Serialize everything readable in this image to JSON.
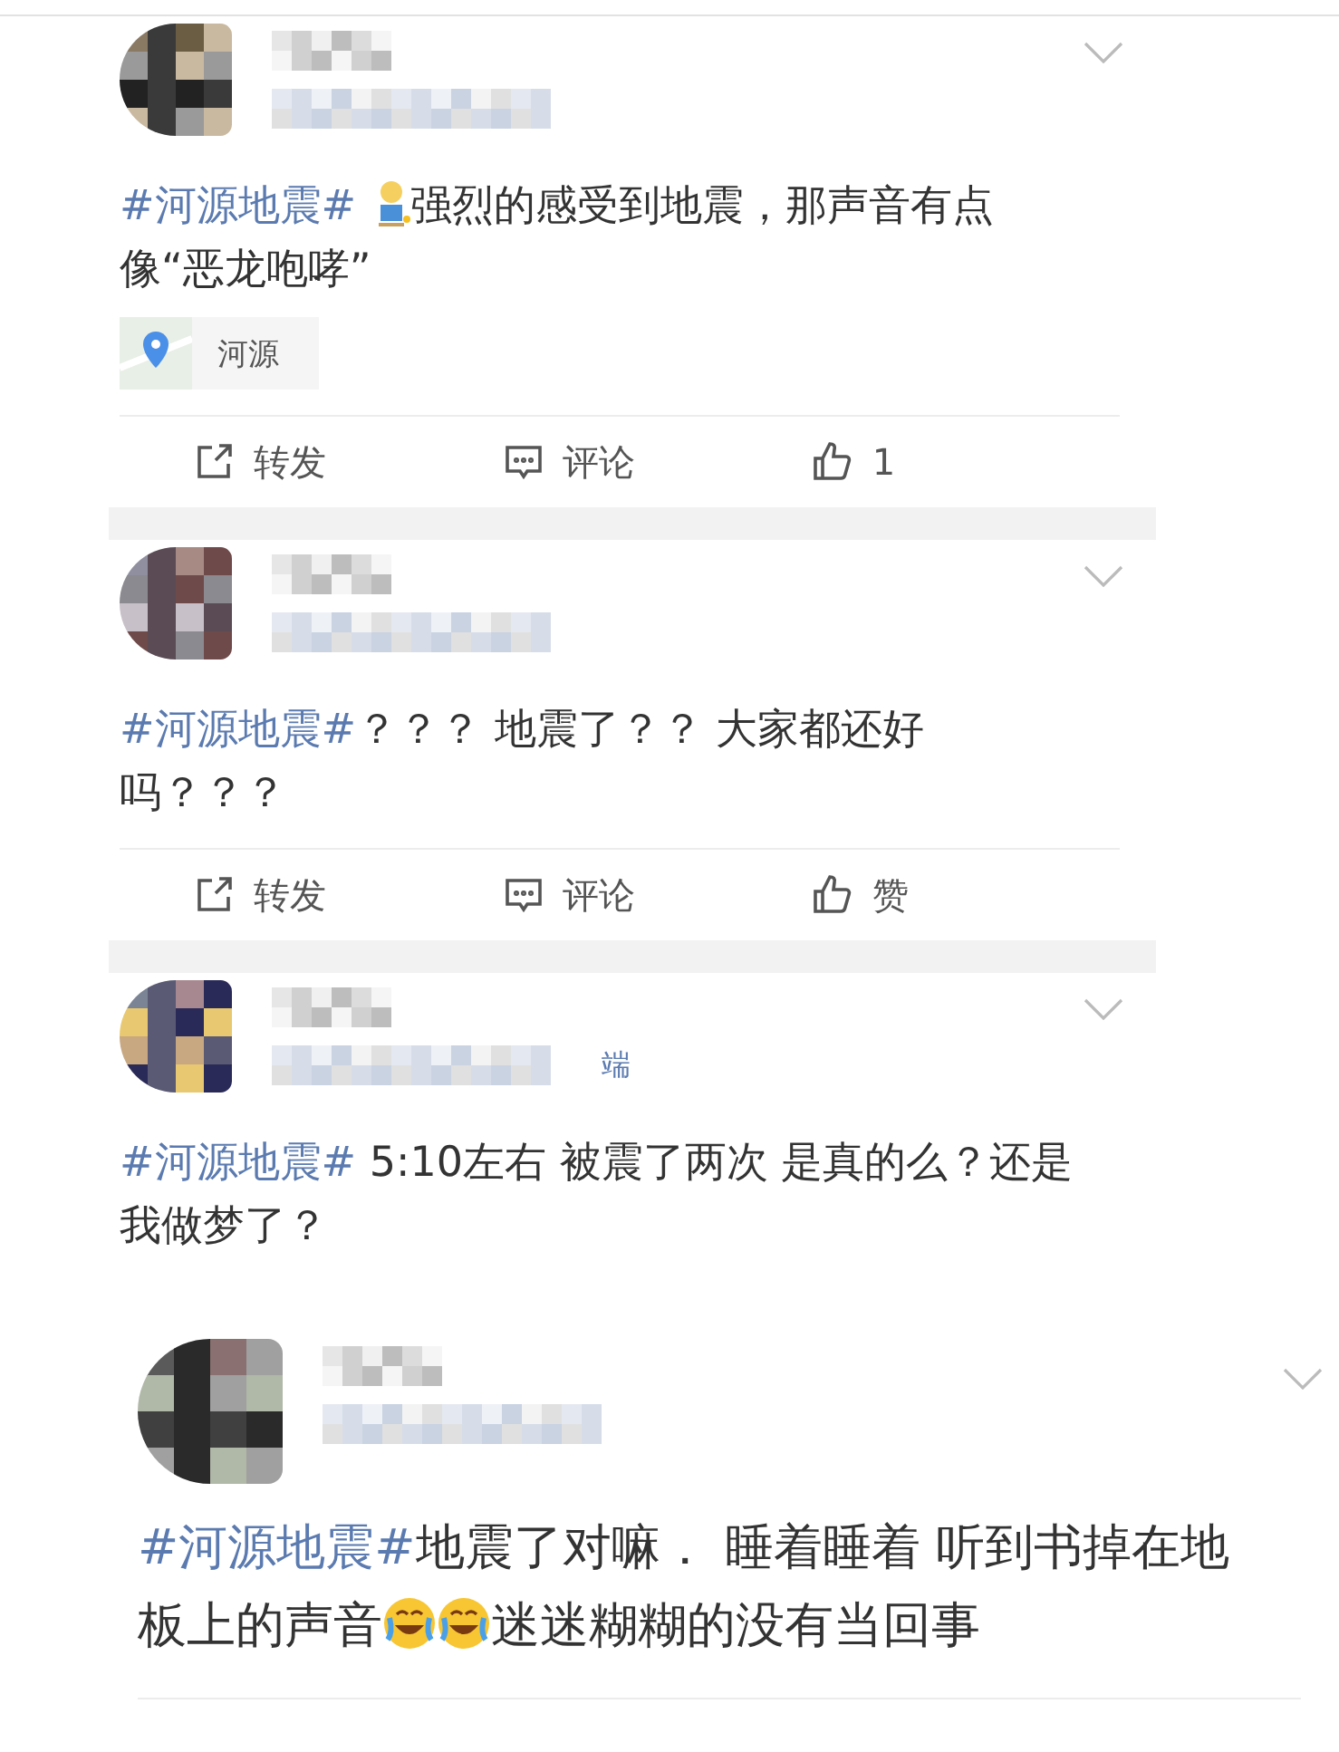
{
  "posts": [
    {
      "parts": [
        {
          "kind": "hashtag",
          "text": "#河源地震#"
        },
        {
          "kind": "emoji"
        },
        {
          "kind": "text",
          "text": "强烈的感受到地震，那声音有点像“恶龙咆哮”"
        }
      ],
      "location": "河源",
      "actions": [
        {
          "kind": "repost",
          "label": "转发"
        },
        {
          "kind": "comment",
          "label": "评论"
        },
        {
          "kind": "like",
          "label": "1"
        }
      ]
    },
    {
      "parts": [
        {
          "kind": "hashtag",
          "text": "#河源地震#"
        },
        {
          "kind": "text",
          "text": "？？？ 地震了？？ 大家都还好吗？？？"
        }
      ],
      "actions": [
        {
          "kind": "repost",
          "label": "转发"
        },
        {
          "kind": "comment",
          "label": "评论"
        },
        {
          "kind": "like",
          "label": "赞"
        }
      ]
    },
    {
      "source": "端",
      "parts": [
        {
          "kind": "hashtag",
          "text": "#河源地震#"
        },
        {
          "kind": "text",
          "text": " 5:10左右 被震了两次 是真的么？还是我做梦了？"
        }
      ]
    },
    {
      "parts": [
        {
          "kind": "hashtag",
          "text": "#河源地震#"
        },
        {
          "kind": "text",
          "text": "地震了对嘛．  睡着睡着  听到书掉在地板上的声音"
        },
        {
          "kind": "laugh"
        },
        {
          "kind": "laugh"
        },
        {
          "kind": "text",
          "text": "迷迷糊糊的没有当回事"
        }
      ]
    }
  ]
}
